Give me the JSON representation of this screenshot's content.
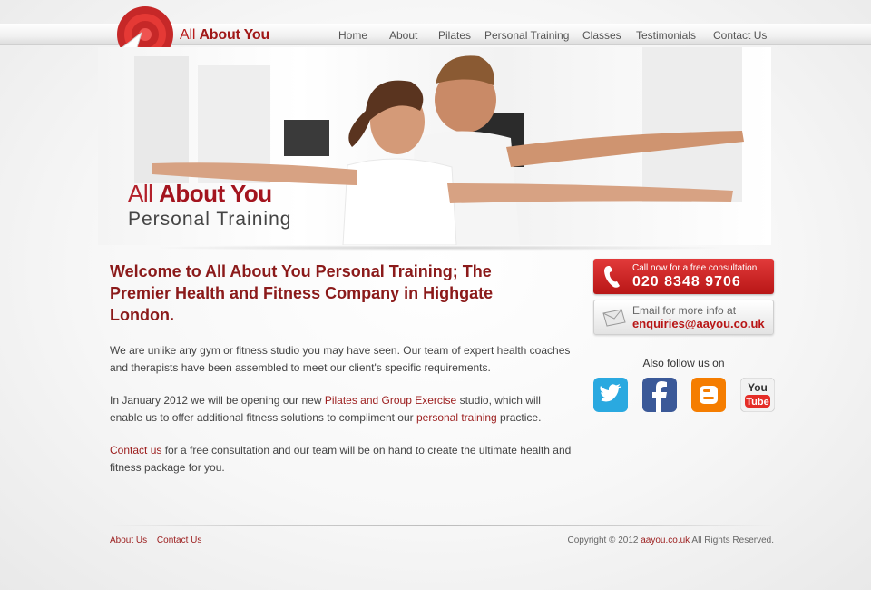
{
  "header": {
    "brand_light": "All ",
    "brand_bold": "About You",
    "nav": [
      "Home",
      "About",
      "Pilates",
      "Personal Training",
      "Classes",
      "Testimonials",
      "Contact Us"
    ]
  },
  "hero": {
    "line1_light": "All ",
    "line1_bold": "About You",
    "line2": "Personal Training"
  },
  "main": {
    "headline": "Welcome to All About You Personal Training; The Premier Health and Fitness Company in Highgate London.",
    "p1": "We are unlike any gym or fitness studio you may have seen. Our team of expert health coaches and therapists have been assembled to meet our client's specific requirements.",
    "p2_a": "In January 2012 we will be opening our new ",
    "p2_link1": "Pilates and Group Exercise",
    "p2_b": " studio, which will enable us to offer additional fitness solutions to compliment our ",
    "p2_link2": "personal training",
    "p2_c": " practice.",
    "p3_link": "Contact us",
    "p3_rest": " for a free consultation and our team will be on hand to create the ultimate health and fitness package for you."
  },
  "sidebar": {
    "call_small": "Call now for a free consultation",
    "call_number": "020 8348 9706",
    "email_small": "Email for more info at",
    "email_addr": "enquiries@aayou.co.uk",
    "follow_label": "Also follow us on",
    "social": [
      "twitter-icon",
      "facebook-icon",
      "blogger-icon",
      "youtube-icon"
    ]
  },
  "footer": {
    "links": [
      "About Us",
      "Contact Us"
    ],
    "copy_a": "Copyright © 2012 ",
    "copy_link": "aayou.co.uk",
    "copy_b": " All Rights Reserved."
  },
  "colors": {
    "brand_red": "#b71c1c",
    "link_red": "#9b1c1c",
    "twitter": "#2aa9e0",
    "facebook": "#3b5998",
    "blogger": "#f57d00",
    "youtube": "#e52d27"
  }
}
